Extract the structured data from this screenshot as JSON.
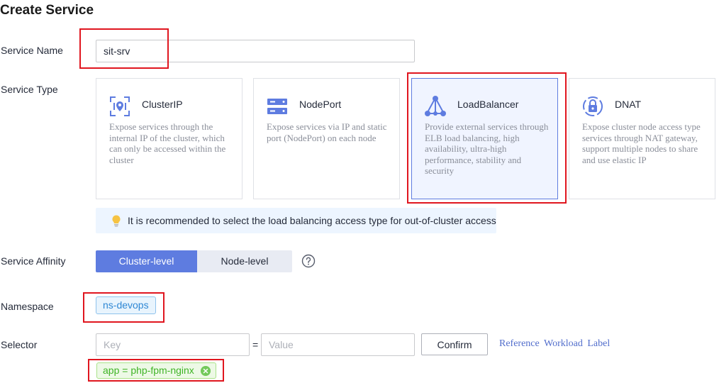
{
  "page": {
    "title": "Create Service"
  },
  "service_name": {
    "label": "Service Name",
    "value": "sit-srv"
  },
  "service_type": {
    "label": "Service Type",
    "selected": "LoadBalancer",
    "cards": [
      {
        "title": "ClusterIP",
        "icon": "cluster-ip-icon",
        "description": "Expose services through the internal IP of the cluster, which can only be accessed within the cluster"
      },
      {
        "title": "NodePort",
        "icon": "node-port-icon",
        "description": "Expose services via IP and static port (NodePort) on each node"
      },
      {
        "title": "LoadBalancer",
        "icon": "load-balancer-icon",
        "description": "Provide external services through ELB load balancing, high availability, ultra-high performance, stability and security"
      },
      {
        "title": "DNAT",
        "icon": "dnat-icon",
        "description": "Expose cluster node access type services through NAT gateway, support multiple nodes to share and use elastic IP"
      }
    ],
    "tip": "It is recommended to select the load balancing access type for out-of-cluster access"
  },
  "service_affinity": {
    "label": "Service Affinity",
    "options": [
      "Cluster-level",
      "Node-level"
    ],
    "selected": "Cluster-level"
  },
  "namespace": {
    "label": "Namespace",
    "value": "ns-devops"
  },
  "selector": {
    "label": "Selector",
    "key_placeholder": "Key",
    "equals": "=",
    "value_placeholder": "Value",
    "confirm_label": "Confirm",
    "reference_link": "Reference Workload Label",
    "tag": "app = php-fpm-nginx"
  },
  "colors": {
    "accent": "#5e7ce0",
    "highlight": "#e0161f",
    "tag_green": "#3fb426",
    "tag_blue": "#2e87d4"
  }
}
